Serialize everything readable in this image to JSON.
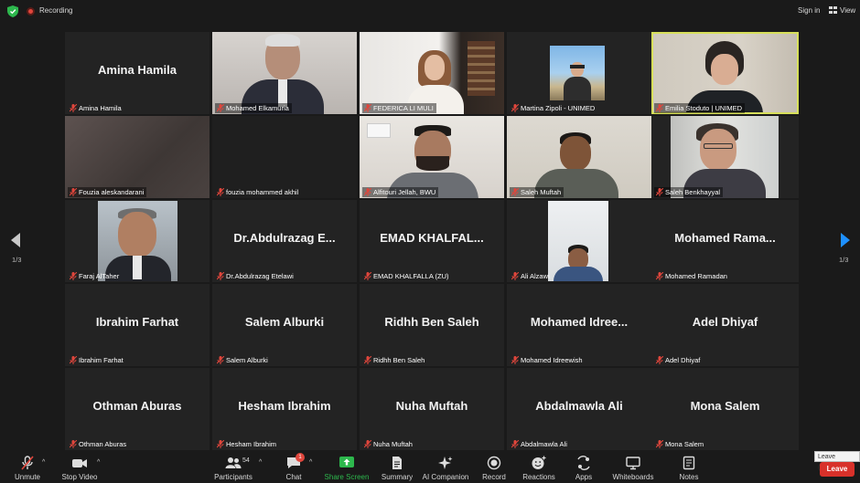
{
  "topbar": {
    "recording_label": "Recording",
    "signin_label": "Sign in",
    "view_label": "View"
  },
  "pagination": {
    "left": "1/3",
    "right": "1/3"
  },
  "participants": [
    {
      "big_name": "Amina Hamila",
      "label": "Amina Hamila",
      "video": false
    },
    {
      "big_name": "",
      "label": "Mohamed Elkamuria",
      "video": true
    },
    {
      "big_name": "",
      "label": "FEDERICA LI MULI",
      "video": true
    },
    {
      "big_name": "",
      "label": "Martina Zipoli - UNIMED",
      "video": true
    },
    {
      "big_name": "",
      "label": "Emilia Stoduto | UNIMED",
      "video": true,
      "active_speaker": true
    },
    {
      "big_name": "",
      "label": "Fouzia aleskandarani",
      "video": true
    },
    {
      "big_name": "",
      "label": "fouzia mohammed akhil",
      "video": false
    },
    {
      "big_name": "",
      "label": "Alfitouri Jellah, BWU",
      "video": true
    },
    {
      "big_name": "",
      "label": "Saleh Muftah",
      "video": true
    },
    {
      "big_name": "",
      "label": "Saleh Benkhayyal",
      "video": true
    },
    {
      "big_name": "",
      "label": "Faraj AlTaher",
      "video": true
    },
    {
      "big_name": "Dr.Abdulrazag  E...",
      "label": "Dr.Abdulrazag Etelawi",
      "video": false
    },
    {
      "big_name": "EMAD  KHALFAL...",
      "label": "EMAD KHALFALLA (ZU)",
      "video": false
    },
    {
      "big_name": "",
      "label": "Ali Alzawi",
      "video": true
    },
    {
      "big_name": "Mohamed  Rama...",
      "label": "Mohamed Ramadan",
      "video": false
    },
    {
      "big_name": "Ibrahim Farhat",
      "label": "Ibrahim Farhat",
      "video": false
    },
    {
      "big_name": "Salem Alburki",
      "label": "Salem Alburki",
      "video": false
    },
    {
      "big_name": "Ridhh Ben Saleh",
      "label": "Ridhh Ben Saleh",
      "video": false
    },
    {
      "big_name": "Mohamed  Idree...",
      "label": "Mohamed Idreewish",
      "video": false
    },
    {
      "big_name": "Adel Dhiyaf",
      "label": "Adel Dhiyaf",
      "video": false
    },
    {
      "big_name": "Othman Aburas",
      "label": "Othman Aburas",
      "video": false
    },
    {
      "big_name": "Hesham Ibrahim",
      "label": "Hesham Ibrahim",
      "video": false
    },
    {
      "big_name": "Nuha Muftah",
      "label": "Nuha Muftah",
      "video": false
    },
    {
      "big_name": "Abdalmawla Ali",
      "label": "Abdalmawla Ali",
      "video": false
    },
    {
      "big_name": "Mona Salem",
      "label": "Mona Salem",
      "video": false
    }
  ],
  "toolbar": {
    "unmute": "Unmute",
    "stop_video": "Stop Video",
    "participants": "Participants",
    "participants_count": "54",
    "chat": "Chat",
    "chat_badge": "1",
    "share_screen": "Share Screen",
    "summary": "Summary",
    "ai_companion": "AI Companion",
    "record": "Record",
    "reactions": "Reactions",
    "apps": "Apps",
    "whiteboards": "Whiteboards",
    "notes": "Notes",
    "leave": "Leave",
    "leave_tooltip": "Leave (Alt+Q)"
  },
  "colors": {
    "share_green": "#2db84d",
    "active_outline": "#d7df5a",
    "leave_red": "#d8312a",
    "nav_blue": "#1e90ff"
  }
}
